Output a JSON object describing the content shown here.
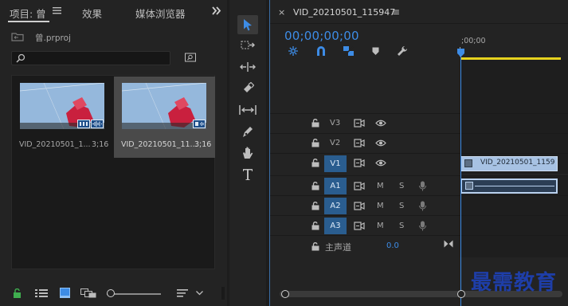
{
  "project_panel": {
    "tabs": [
      "项目: 曾",
      "效果",
      "媒体浏览器"
    ],
    "menu_icon": "hamburger-icon",
    "overflow_icon": "double-chevron-right-icon",
    "bin_name": "曾.prproj",
    "search_value": "",
    "clips": [
      {
        "name": "VID_20210501_1...",
        "duration": "3;16",
        "selected": false
      },
      {
        "name": "VID_20210501_11...",
        "duration": "3;16",
        "selected": true
      }
    ]
  },
  "tools": [
    "selection-tool",
    "track-select-forward-tool",
    "ripple-edit-tool",
    "razor-tool",
    "slip-tool",
    "pen-tool",
    "hand-tool",
    "type-tool"
  ],
  "timeline": {
    "close_symbol": "×",
    "sequence_name": "VID_20210501_115947",
    "menu_symbol": "≡",
    "timecode": "00;00;00;00",
    "ruler_label": ";00;00",
    "tracks": [
      {
        "id": "V3",
        "kind": "video",
        "targeted": false
      },
      {
        "id": "V2",
        "kind": "video",
        "targeted": false
      },
      {
        "id": "V1",
        "kind": "video",
        "targeted": true,
        "clip": "VID_20210501_1159"
      },
      {
        "id": "A1",
        "kind": "audio",
        "targeted": true,
        "m": "M",
        "s": "S"
      },
      {
        "id": "A2",
        "kind": "audio",
        "targeted": true,
        "m": "M",
        "s": "S"
      },
      {
        "id": "A3",
        "kind": "audio",
        "targeted": true,
        "m": "M",
        "s": "S"
      }
    ],
    "master": {
      "label": "主声道",
      "value": "0.0"
    }
  },
  "watermark": "最需教育",
  "colors": {
    "accent": "#3d8ce6",
    "target_on": "#2a5d8f",
    "clip": "#a7c2e3",
    "work_bar": "#e6d21e",
    "watermark": "#1e3ea8"
  }
}
